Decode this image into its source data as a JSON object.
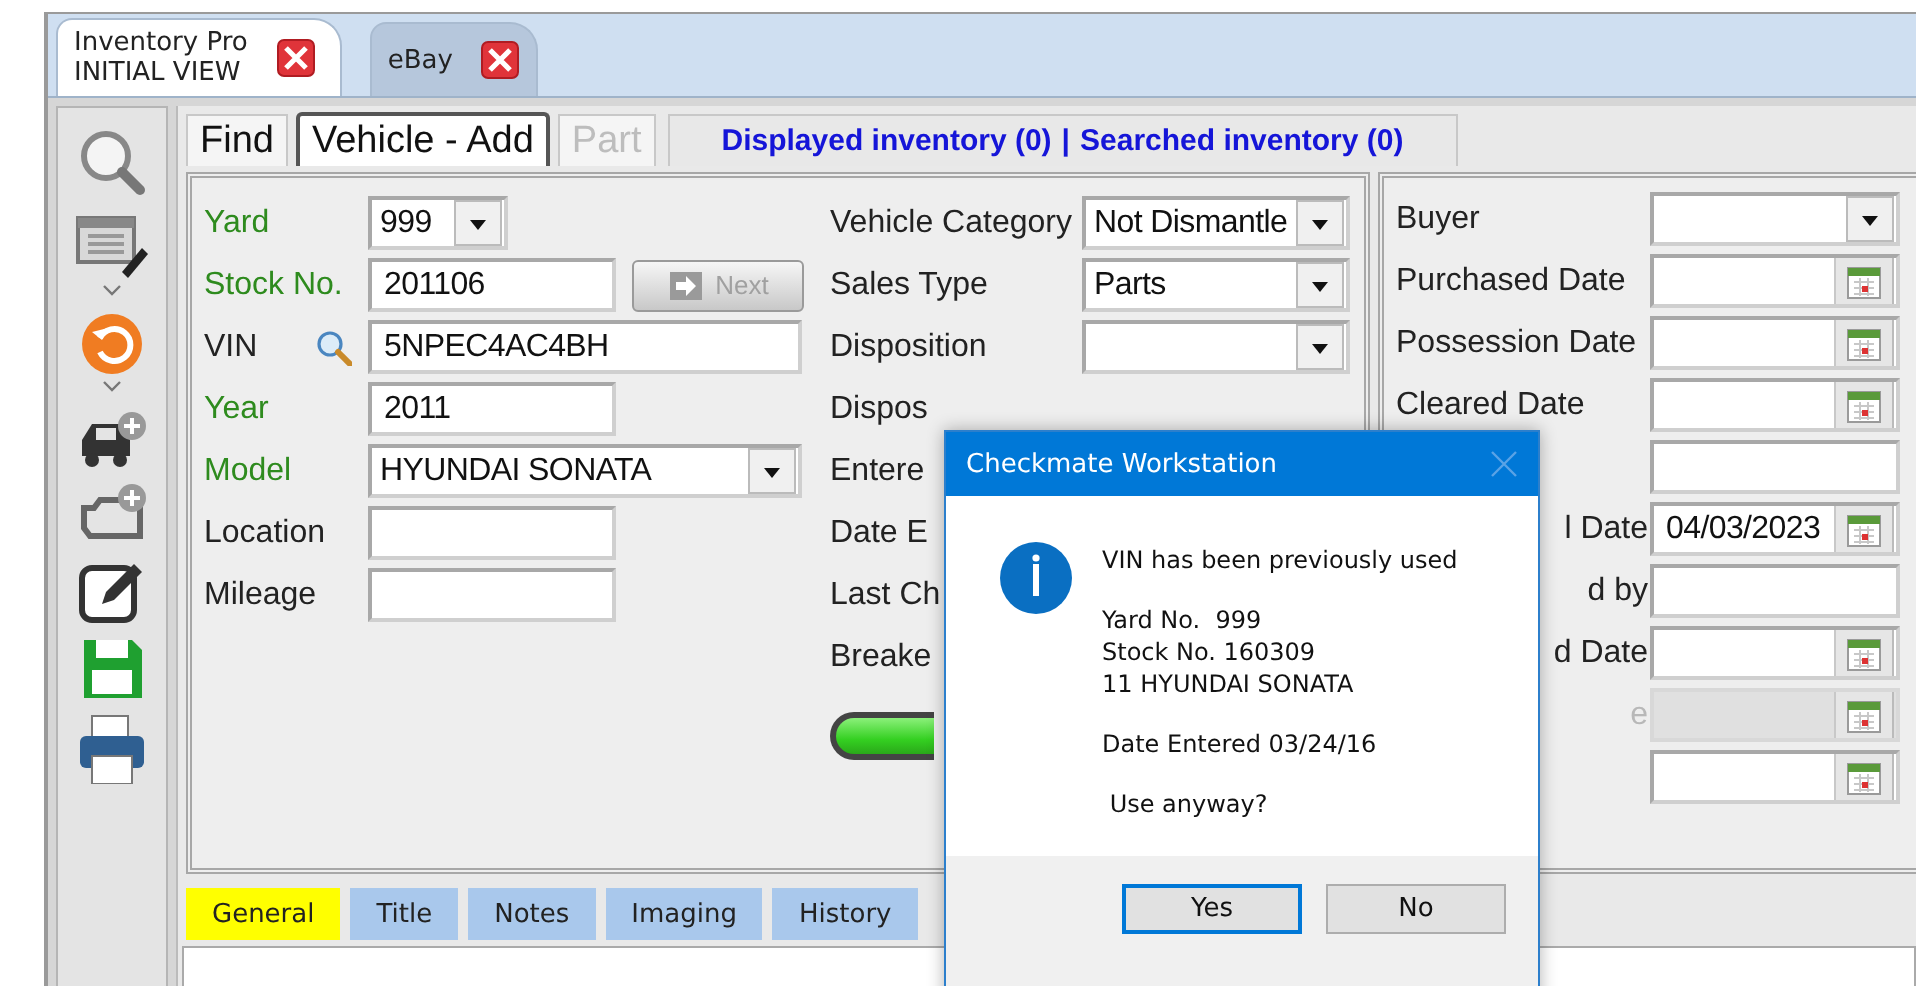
{
  "app_tabs": [
    {
      "title": "Inventory Pro",
      "subtitle": "INITIAL VIEW",
      "selected": true
    },
    {
      "title": "eBay",
      "selected": false
    }
  ],
  "form_tabs": [
    {
      "label": "Find",
      "selected": false,
      "disabled": false
    },
    {
      "label": "Vehicle - Add",
      "selected": true,
      "disabled": false
    },
    {
      "label": "Part",
      "selected": false,
      "disabled": true
    }
  ],
  "inventory_links": [
    {
      "label": "Displayed inventory (0)"
    },
    {
      "label": "Searched inventory (0)"
    }
  ],
  "link_separator": "|",
  "left_fields": [
    {
      "label": "Yard",
      "required": true,
      "kind": "dropdown",
      "value": "999"
    },
    {
      "label": "Stock No.",
      "required": true,
      "kind": "text",
      "value": "201106",
      "button": {
        "label": "Next",
        "disabled": true
      }
    },
    {
      "label": "VIN",
      "required": false,
      "kind": "lookup",
      "value": "5NPEC4AC4BH"
    },
    {
      "label": "Year",
      "required": true,
      "kind": "text",
      "value": "2011"
    },
    {
      "label": "Model",
      "required": true,
      "kind": "dropdown",
      "value": "HYUNDAI SONATA"
    },
    {
      "label": "Location",
      "required": false,
      "kind": "text"
    },
    {
      "label": "Mileage",
      "required": false,
      "kind": "text"
    }
  ],
  "middle_fields": [
    {
      "label": "Vehicle Category",
      "kind": "dropdown",
      "value": "Not Dismantle"
    },
    {
      "label": "Sales Type",
      "kind": "dropdown",
      "value": "Parts"
    },
    {
      "label": "Disposition",
      "kind": "dropdown"
    },
    {
      "label": "Dispos",
      "kind": "label"
    },
    {
      "label": "Entere",
      "kind": "label"
    },
    {
      "label": "Date E",
      "kind": "label"
    },
    {
      "label": "Last Ch",
      "kind": "label"
    },
    {
      "label": "Breake",
      "kind": "label"
    }
  ],
  "right_fields": [
    {
      "label": "Buyer",
      "kind": "dropdown",
      "disabled": false
    },
    {
      "label": "Purchased Date",
      "kind": "date",
      "disabled": false
    },
    {
      "label": "Possession Date",
      "kind": "date",
      "disabled": false
    },
    {
      "label": "Cleared Date",
      "kind": "date",
      "disabled": false
    },
    {
      "kind": "text",
      "disabled": false
    },
    {
      "label": "l Date",
      "kind": "date",
      "value": "04/03/2023",
      "disabled": false
    },
    {
      "label": "d by",
      "kind": "text",
      "disabled": false
    },
    {
      "label": "d Date",
      "kind": "date",
      "disabled": false
    },
    {
      "label": "e",
      "kind": "date",
      "disabled": true
    },
    {
      "kind": "date",
      "disabled": false
    }
  ],
  "bottom_tabs": [
    {
      "label": "General",
      "selected": true
    },
    {
      "label": "Title",
      "selected": false
    },
    {
      "label": "Notes",
      "selected": false
    },
    {
      "label": "Imaging",
      "selected": false
    },
    {
      "label": "History",
      "selected": false
    }
  ],
  "dialog": {
    "title": "Checkmate Workstation",
    "message": [
      "VIN has been previously used",
      "Yard No.  999\nStock No. 160309\n11 HYUNDAI SONATA",
      "Date Entered 03/24/16",
      " Use anyway?"
    ],
    "buttons": [
      {
        "label": "Yes",
        "selected": true
      },
      {
        "label": "No",
        "selected": false
      }
    ]
  }
}
